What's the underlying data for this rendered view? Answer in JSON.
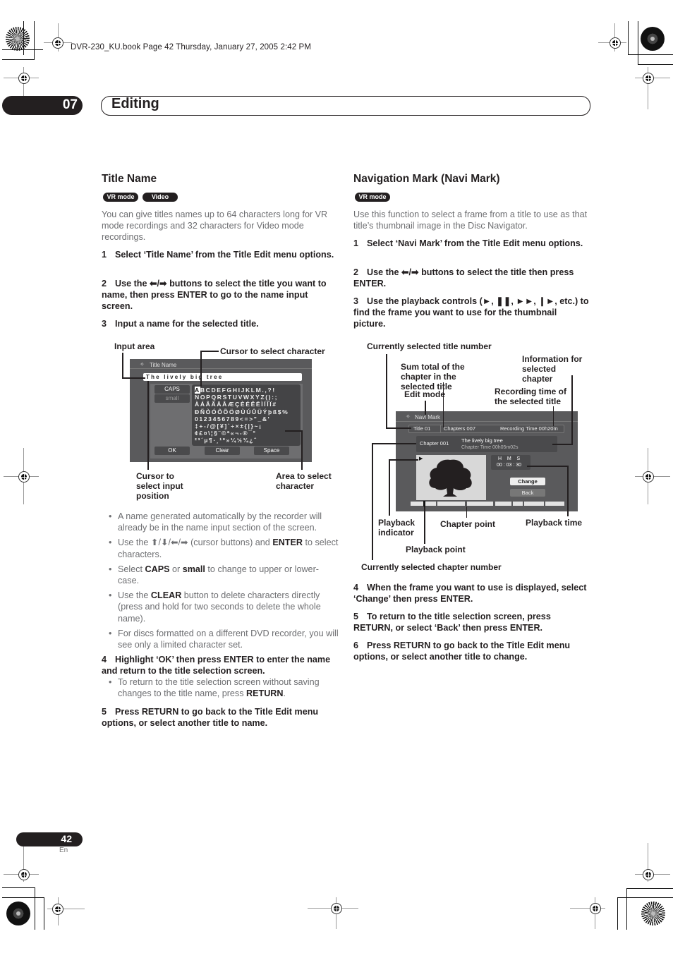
{
  "header": {
    "meta": "DVR-230_KU.book  Page 42  Thursday, January 27, 2005  2:42 PM",
    "chapter_number": "07",
    "chapter_title": "Editing"
  },
  "title_name": {
    "heading": "Title Name",
    "badges": [
      "VR mode",
      "Video mode"
    ],
    "intro": "You can give titles names up to 64 characters long for VR mode recordings and 32 characters for Video mode recordings.",
    "steps": [
      {
        "n": "1",
        "text": "Select ‘Title Name’ from the Title Edit menu options."
      },
      {
        "n": "2",
        "text": "Use the ⬅/➡ buttons to select the title you want to name, then press ENTER to go to the name input screen."
      },
      {
        "n": "3",
        "text": "Input a name for the selected title."
      }
    ],
    "screen": {
      "menu_title": "Title Name",
      "input_value": "The lively big tree",
      "mode_buttons": [
        "CAPS",
        "small"
      ],
      "char_rows": [
        "ABCDEFGHIJKLM.,?!",
        "NOPQRSTUVWXYZ():;",
        "ÀÁÂÃÄÅÆÇÈÉÊËÌÍÎÏ#",
        "ÐÑÒÓÔÕÖØÙÚÛÜÝþß$%",
        "0123456789<=>\"_&'",
        "‡+-/@[¥]`÷×±{|}~¡",
        "¢£¤\\¦§¨©ª«¬-®¯°",
        "²³´µ¶·¸¹º»¼½¾¿ˆ"
      ],
      "selected_char": "A",
      "action_buttons": [
        "OK",
        "Clear",
        "Space"
      ]
    },
    "callouts": {
      "input_area": "Input area",
      "cursor_char": "Cursor to select character",
      "cursor_input": "Cursor to select input position",
      "area_select": "Area to select character"
    },
    "bullets": [
      {
        "parts": [
          {
            "t": "A name generated automatically by the recorder will already be in the name input section of the screen.",
            "b": false
          }
        ]
      },
      {
        "parts": [
          {
            "t": "Use the ⬆/⬇/⬅/➡ (cursor buttons) and ",
            "b": false
          },
          {
            "t": "ENTER",
            "b": true
          },
          {
            "t": " to select characters.",
            "b": false
          }
        ]
      },
      {
        "parts": [
          {
            "t": "Select ",
            "b": false
          },
          {
            "t": "CAPS",
            "b": true
          },
          {
            "t": " or ",
            "b": false
          },
          {
            "t": "small",
            "b": true
          },
          {
            "t": " to change to upper or lower-case.",
            "b": false
          }
        ]
      },
      {
        "parts": [
          {
            "t": "Use the ",
            "b": false
          },
          {
            "t": "CLEAR",
            "b": true
          },
          {
            "t": " button to delete characters directly (press and hold for two seconds to delete the whole name).",
            "b": false
          }
        ]
      },
      {
        "parts": [
          {
            "t": "For discs formatted on a different DVD recorder, you will see only a limited character set.",
            "b": false
          }
        ]
      }
    ],
    "step4": {
      "n": "4",
      "text": "Highlight ‘OK’ then press ENTER to enter the name and return to the title selection screen."
    },
    "step4_bullet": [
      {
        "t": "To return to the title selection screen without saving changes to the title name, press ",
        "b": false
      },
      {
        "t": "RETURN",
        "b": true
      },
      {
        "t": ".",
        "b": false
      }
    ],
    "step5": {
      "n": "5",
      "text": "Press RETURN to go back to the Title Edit menu options, or select another title to name."
    }
  },
  "navi_mark": {
    "heading": "Navigation Mark (Navi Mark)",
    "badges": [
      "VR mode"
    ],
    "intro": "Use this function to select a frame from a title to use as that title’s thumbnail image in the Disc Navigator.",
    "steps": [
      {
        "n": "1",
        "text": "Select ‘Navi Mark’ from the Title Edit menu options."
      },
      {
        "n": "2",
        "text": "Use the ⬅/➡ buttons to select the title then press ENTER."
      },
      {
        "n": "3",
        "text": "Use the playback controls (►, ❚❚, ►►, ❙►, etc.) to find the frame you want to use for the thumbnail picture."
      }
    ],
    "screen": {
      "menu_title": "Navi Mark",
      "title_number": "Title 01",
      "chapters": "Chapters 007",
      "recording_time": "Recording Time  00h20m",
      "chapter_number": "Chapter 001",
      "chapter_name": "The lively big tree",
      "chapter_time": "Chapter Time  00h05m02s",
      "time_header": "H    M    S",
      "time_value": "00 : 03 : 30",
      "buttons": [
        "Change",
        "Back"
      ]
    },
    "callouts": {
      "title_number": "Currently selected title number",
      "sum_total": "Sum total of the chapter in the selected title",
      "edit_mode": "Edit mode",
      "info_chapter": "Information for selected chapter",
      "rec_time": "Recording time of the selected title",
      "playback_indicator": "Playback indicator",
      "chapter_point": "Chapter point",
      "playback_time": "Playback time",
      "playback_point": "Playback point",
      "chapter_number": "Currently  selected chapter number"
    },
    "steps_after": [
      {
        "n": "4",
        "text": "When the frame you want to use is displayed, select ‘Change’ then press ENTER."
      },
      {
        "n": "5",
        "text": "To return to the title selection screen, press RETURN, or select ‘Back’ then press ENTER."
      },
      {
        "n": "6",
        "text": "Press RETURN to go back to the Title Edit menu options, or select another title to change."
      }
    ]
  },
  "footer": {
    "page_number": "42",
    "language": "En"
  }
}
